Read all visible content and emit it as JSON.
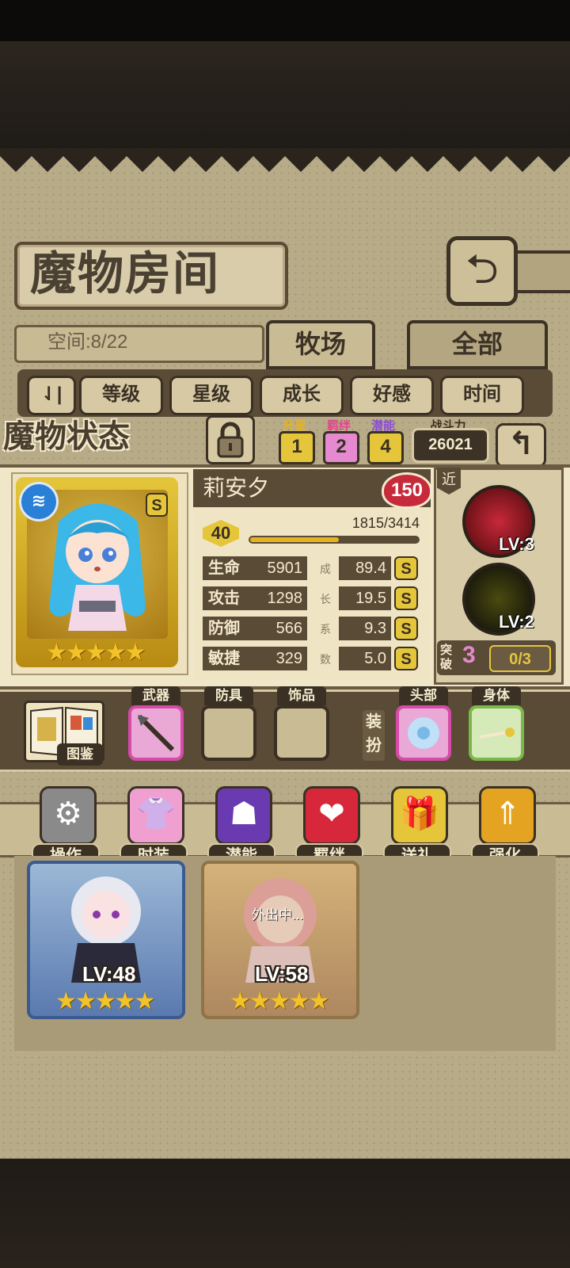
{
  "header": {
    "title": "魔物房间",
    "back_icon": "return-arrow"
  },
  "space": "空间:8/22",
  "tabs": [
    "牧场",
    "全部"
  ],
  "sort": [
    "等级",
    "星级",
    "成长",
    "好感",
    "时间"
  ],
  "status": {
    "title": "魔物状态",
    "star_up": {
      "label": "升星",
      "value": "1"
    },
    "bond": {
      "label": "羁绊",
      "value": "2"
    },
    "potential": {
      "label": "潜能",
      "value": "4"
    },
    "power": {
      "label": "战斗力",
      "value": "26021"
    }
  },
  "monster": {
    "name": "莉安夕",
    "affection": "150",
    "level": "40",
    "exp": "1815/3414",
    "exp_fraction": 0.53,
    "rank_badge": "S",
    "stars": 5,
    "stats": [
      {
        "label": "生命",
        "value": "5901",
        "growth": "89.4",
        "rank": "S"
      },
      {
        "label": "攻击",
        "value": "1298",
        "growth": "19.5",
        "rank": "S"
      },
      {
        "label": "防御",
        "value": "566",
        "growth": "9.3",
        "rank": "S"
      },
      {
        "label": "敏捷",
        "value": "329",
        "growth": "5.0",
        "rank": "S"
      }
    ],
    "growth_chars": [
      "成",
      "长",
      "系",
      "数"
    ]
  },
  "skills": {
    "type": "近",
    "items": [
      {
        "lv": "LV:3",
        "color": "#8e1a1a"
      },
      {
        "lv": "LV:2",
        "color": "#1c1a10"
      }
    ],
    "break_label": "突破",
    "break_value": "3",
    "break_progress": "0/3"
  },
  "equipment": {
    "book": "图鉴",
    "slots": [
      "武器",
      "防具",
      "饰品"
    ],
    "outfit_label": "装扮",
    "outfit": [
      "头部",
      "身体"
    ]
  },
  "actions": [
    "操作",
    "时装",
    "潜能",
    "羁绊",
    "送礼",
    "强化"
  ],
  "list": {
    "away": "外出中...",
    "cards": [
      {
        "lv": "LV:48"
      },
      {
        "lv": "LV:58"
      }
    ]
  }
}
